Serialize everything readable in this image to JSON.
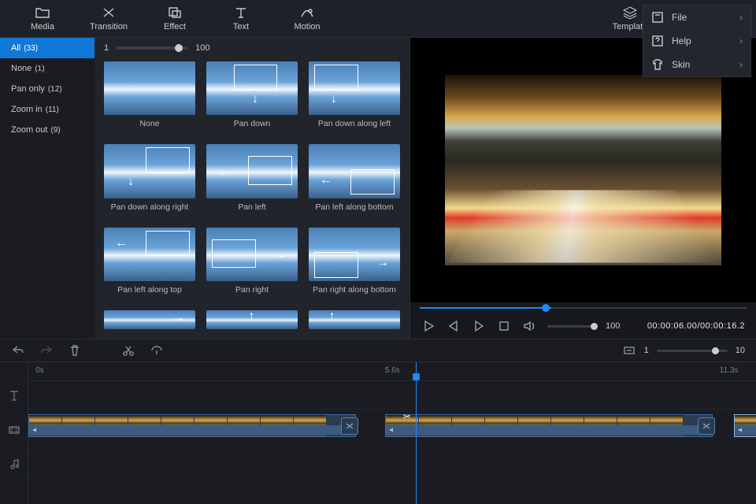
{
  "topnav": {
    "items": [
      {
        "label": "Media"
      },
      {
        "label": "Transition"
      },
      {
        "label": "Effect"
      },
      {
        "label": "Text"
      },
      {
        "label": "Motion"
      }
    ],
    "right": {
      "template": "Template"
    }
  },
  "dropdown": {
    "items": [
      {
        "label": "File"
      },
      {
        "label": "Help"
      },
      {
        "label": "Skin"
      }
    ]
  },
  "sidebar": {
    "items": [
      {
        "label": "All",
        "count": "(33)",
        "sel": true
      },
      {
        "label": "None",
        "count": "(1)"
      },
      {
        "label": "Pan only",
        "count": "(12)"
      },
      {
        "label": "Zoom in",
        "count": "(11)"
      },
      {
        "label": "Zoom out",
        "count": "(9)"
      }
    ]
  },
  "browser": {
    "zoom_min": "1",
    "zoom_max": "100",
    "effects": [
      {
        "label": "None"
      },
      {
        "label": "Pan down"
      },
      {
        "label": "Pan down along left"
      },
      {
        "label": "Pan down along right"
      },
      {
        "label": "Pan left"
      },
      {
        "label": "Pan left along bottom"
      },
      {
        "label": "Pan left along top"
      },
      {
        "label": "Pan right"
      },
      {
        "label": "Pan right along bottom"
      },
      {
        "label": ""
      },
      {
        "label": ""
      },
      {
        "label": ""
      }
    ]
  },
  "preview": {
    "vol": "100",
    "time_cur": "00:00:06.00",
    "time_dur": "00:00:16.2"
  },
  "timeline": {
    "zoom_min": "1",
    "zoom_max": "10",
    "ruler": [
      {
        "label": "0s",
        "pct": 0
      },
      {
        "label": "5.6s",
        "pct": 50
      },
      {
        "label": "11.3s",
        "pct": 98
      }
    ]
  }
}
